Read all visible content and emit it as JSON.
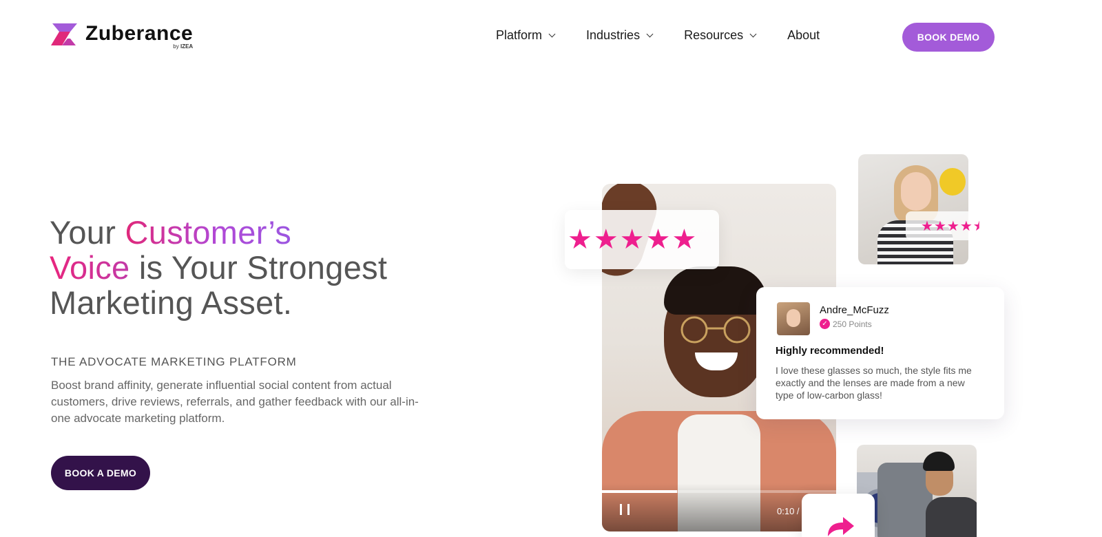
{
  "brand": {
    "name": "Zuberance",
    "by": "by",
    "parent": "IZEA"
  },
  "nav": {
    "items": [
      {
        "label": "Platform",
        "dropdown": true
      },
      {
        "label": "Industries",
        "dropdown": true
      },
      {
        "label": "Resources",
        "dropdown": true
      },
      {
        "label": "About",
        "dropdown": false
      }
    ],
    "cta": "BOOK DEMO"
  },
  "hero": {
    "headline": {
      "part1": "Your ",
      "highlight1": "Customer’s",
      "highlight2": "Voice",
      "part2": " is Your Strongest",
      "part3": "Marketing Asset."
    },
    "eyebrow": "THE ADVOCATE MARKETING PLATFORM",
    "description": "Boost brand affinity, generate influential social content from actual customers, drive reviews, referrals, and gather feedback with our all-in-one advocate marketing platform.",
    "cta": "BOOK A DEMO"
  },
  "video": {
    "time": "0:10 /",
    "progress": 0.32
  },
  "rating": {
    "stars": 5,
    "mini_stars": 4.5
  },
  "review": {
    "username": "Andre_McFuzz",
    "points": "250 Points",
    "title": "Highly recommended!",
    "body": "I love these glasses so much, the style fits me exactly and the lenses are made from a new type of low-carbon glass!"
  },
  "colors": {
    "accent_purple": "#a35bd9",
    "dark_purple": "#33124a",
    "star_pink": "#ee1f8e"
  },
  "icons": [
    "zuberance-logo-icon",
    "chevron-down-icon",
    "star-icon",
    "pause-icon",
    "check-icon",
    "share-icon"
  ]
}
